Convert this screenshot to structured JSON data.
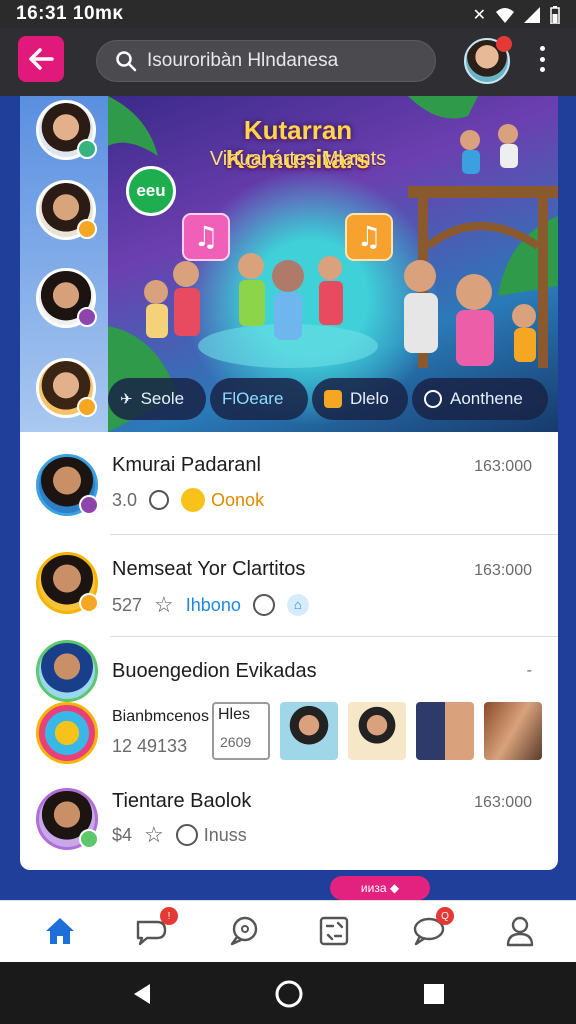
{
  "status_bar": {
    "time": "16:31",
    "extra": "10mκ"
  },
  "top_bar": {
    "search_text": "Isouroribàn Hlndanesa"
  },
  "banner": {
    "title": "Kutarran Komunitars",
    "subtitle": "Virtual ártes Mlamts",
    "badge": "eeu",
    "chips": [
      {
        "label": "Seole",
        "icon": "plane-icon"
      },
      {
        "label": "FlOeare",
        "icon": ""
      },
      {
        "label": "Dlelo",
        "icon": "square-icon"
      },
      {
        "label": "Aonthene",
        "icon": "globe-icon"
      }
    ]
  },
  "feed": {
    "items": [
      {
        "name": "Kmurai Padaranl",
        "time": "163:000",
        "meta_num": "3.0",
        "meta_tag": "Oonok"
      },
      {
        "name": "Nemseat Yor Clartitos",
        "time": "163:000",
        "meta_num": "527",
        "meta_tag": "Ihbono"
      },
      {
        "name": "Buoengedion Evikadas",
        "time": "-",
        "sub_name": "Bianbmcenos",
        "sub_box": "Hles",
        "meta_num": "12 49133",
        "box_meta": "2609"
      },
      {
        "name": "Tientare Baolok",
        "time": "163:000",
        "meta_num": "$4",
        "meta_tag": "Inuss"
      }
    ]
  },
  "float_pill": {
    "label": "ииза ◆"
  },
  "colors": {
    "accent": "#e0197a",
    "blue": "#1565c0",
    "background": "#1f3f9a"
  }
}
